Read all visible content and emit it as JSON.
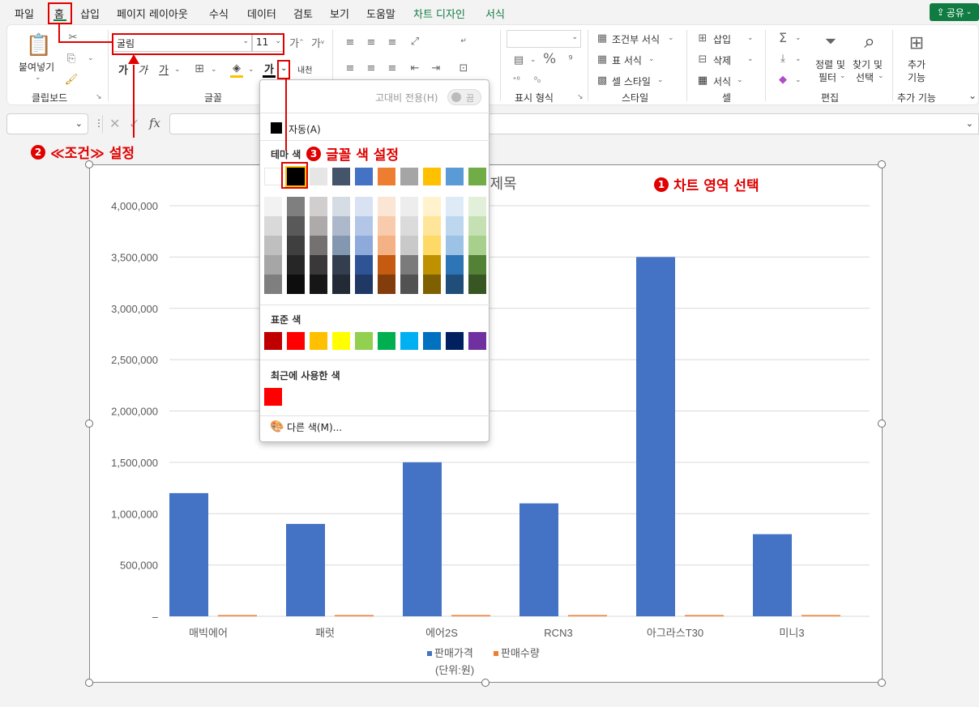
{
  "menu": {
    "tabs": [
      "파일",
      "홈",
      "삽입",
      "페이지 레이아웃",
      "수식",
      "데이터",
      "검토",
      "보기",
      "도움말",
      "차트 디자인",
      "서식"
    ],
    "share": "공유"
  },
  "ribbon": {
    "clipboard": {
      "paste": "붙여넣기",
      "label": "클립보드"
    },
    "font": {
      "name": "굴림",
      "size": "11",
      "label": "글꼴",
      "wrap": "내천"
    },
    "number": {
      "label": "표시 형식",
      "percent": "%"
    },
    "styles": {
      "conditional": "조건부 서식",
      "table": "표 서식",
      "cell": "셀 스타일",
      "label": "스타일"
    },
    "cells": {
      "insert": "삽입",
      "delete": "삭제",
      "format": "서식",
      "label": "셀"
    },
    "editing": {
      "sort": "정렬 및",
      "filter": "필터",
      "find": "찾기 및",
      "select": "선택",
      "label": "편집"
    },
    "addins": {
      "add1": "추가",
      "add2": "기능",
      "label": "추가 기능"
    }
  },
  "color_menu": {
    "high_contrast": "고대비 전용(H)",
    "toggle": "끔",
    "auto": "자동(A)",
    "theme_heading": "테마 색",
    "standard_heading": "표준 색",
    "recent_heading": "최근에 사용한 색",
    "more_colors": "다른 색(M)...",
    "theme_colors": [
      "#ffffff",
      "#000000",
      "#e7e6e6",
      "#44546a",
      "#4472c4",
      "#ed7d31",
      "#a5a5a5",
      "#ffc000",
      "#5b9bd5",
      "#70ad47"
    ],
    "theme_shades": [
      [
        "#f2f2f2",
        "#d9d9d9",
        "#bfbfbf",
        "#a6a6a6",
        "#7f7f7f"
      ],
      [
        "#7f7f7f",
        "#595959",
        "#3f3f3f",
        "#262626",
        "#0d0d0d"
      ],
      [
        "#d0cece",
        "#aeaaaa",
        "#757171",
        "#3a3838",
        "#171616"
      ],
      [
        "#d6dce4",
        "#adb9ca",
        "#8497b0",
        "#333f4f",
        "#222a35"
      ],
      [
        "#d9e2f3",
        "#b4c6e7",
        "#8eaadb",
        "#2f5496",
        "#1f3864"
      ],
      [
        "#fbe5d5",
        "#f7cbac",
        "#f4b183",
        "#c55a11",
        "#833c0b"
      ],
      [
        "#ededed",
        "#dbdbdb",
        "#c9c9c9",
        "#7b7b7b",
        "#525252"
      ],
      [
        "#fff2cc",
        "#fee599",
        "#ffd966",
        "#bf9000",
        "#7f6000"
      ],
      [
        "#deebf6",
        "#bdd7ee",
        "#9cc3e5",
        "#2e75b5",
        "#1e4e79"
      ],
      [
        "#e2efd9",
        "#c5e0b3",
        "#a8d08d",
        "#538135",
        "#375623"
      ]
    ],
    "standard_colors": [
      "#c00000",
      "#ff0000",
      "#ffc000",
      "#ffff00",
      "#92d050",
      "#00b050",
      "#00b0f0",
      "#0070c0",
      "#002060",
      "#7030a0"
    ],
    "recent_colors": [
      "#ff0000"
    ]
  },
  "annotations": {
    "step1": "차트 영역 선택",
    "step2": "≪조건≫ 설정",
    "step3": "글꼴 색 설정",
    "n1": "1",
    "n2": "2",
    "n3": "3"
  },
  "chart_data": {
    "type": "bar",
    "title": "제목",
    "categories": [
      "매빅에어",
      "패럿",
      "에어2S",
      "RCN3",
      "아그라스T30",
      "미니3"
    ],
    "series": [
      {
        "name": "판매가격",
        "color": "#4472c4",
        "values": [
          1200000,
          900000,
          1500000,
          1100000,
          3500000,
          800000
        ]
      },
      {
        "name": "판매수량",
        "color": "#ed7d31",
        "values": [
          10,
          8,
          12,
          9,
          5,
          15
        ]
      }
    ],
    "ylim": [
      0,
      4000000
    ],
    "yticks": [
      "–",
      "500,000",
      "1,000,000",
      "1,500,000",
      "2,000,000",
      "2,500,000",
      "3,000,000",
      "3,500,000",
      "4,000,000"
    ],
    "legend_note": "(단위:원)",
    "legend_position": "bottom",
    "grid": true
  }
}
